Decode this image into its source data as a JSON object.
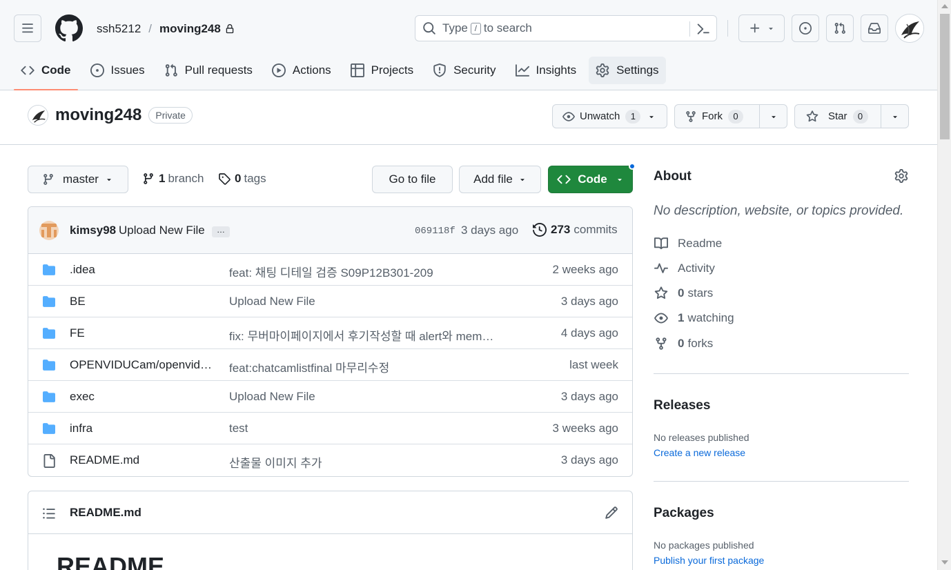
{
  "colors": {
    "accent_green": "#1f883d",
    "link_blue": "#0969da",
    "folder_blue": "#54aeff",
    "tab_underline": "#fd8c73",
    "muted_text": "#57606a",
    "border": "#d0d7de"
  },
  "header": {
    "owner": "ssh5212",
    "separator": "/",
    "repo": "moving248",
    "search": {
      "prefix": "Type",
      "key": "/",
      "suffix": "to search"
    }
  },
  "tabs": [
    {
      "label": "Code",
      "icon": "code-icon"
    },
    {
      "label": "Issues",
      "icon": "issue-icon"
    },
    {
      "label": "Pull requests",
      "icon": "pull-request-icon"
    },
    {
      "label": "Actions",
      "icon": "play-icon"
    },
    {
      "label": "Projects",
      "icon": "table-icon"
    },
    {
      "label": "Security",
      "icon": "shield-icon"
    },
    {
      "label": "Insights",
      "icon": "graph-icon"
    },
    {
      "label": "Settings",
      "icon": "gear-icon"
    }
  ],
  "repo": {
    "name": "moving248",
    "visibility": "Private",
    "watch": {
      "label": "Unwatch",
      "count": "1"
    },
    "fork": {
      "label": "Fork",
      "count": "0"
    },
    "star": {
      "label": "Star",
      "count": "0"
    }
  },
  "branch_bar": {
    "branch": "master",
    "branches_count": "1",
    "branches_label": "branch",
    "tags_count": "0",
    "tags_label": "tags",
    "go_to_file": "Go to file",
    "add_file": "Add file",
    "code": "Code"
  },
  "latest_commit": {
    "author": "kimsy98",
    "message": "Upload New File",
    "ellipsis": "…",
    "sha": "069118f",
    "date": "3 days ago",
    "commits_count": "273",
    "commits_label": "commits"
  },
  "files": [
    {
      "name": ".idea",
      "type": "dir",
      "message": "feat: 채팅 디테일 검증 S09P12B301-209",
      "date": "2 weeks ago"
    },
    {
      "name": "BE",
      "type": "dir",
      "message": "Upload New File",
      "date": "3 days ago"
    },
    {
      "name": "FE",
      "type": "dir",
      "message": "fix: 무버마이페이지에서 후기작성할 때 alert와 mem…",
      "date": "4 days ago"
    },
    {
      "name": "OPENVIDUCam/openvid…",
      "type": "dir",
      "message": "feat:chatcamlistfinal 마무리수정",
      "date": "last week"
    },
    {
      "name": "exec",
      "type": "dir",
      "message": "Upload New File",
      "date": "3 days ago"
    },
    {
      "name": "infra",
      "type": "dir",
      "message": "test",
      "date": "3 weeks ago"
    },
    {
      "name": "README.md",
      "type": "file",
      "message": "산출물 이미지 추가",
      "date": "3 days ago"
    }
  ],
  "readme": {
    "filename": "README.md",
    "heading": "README"
  },
  "about": {
    "title": "About",
    "description": "No description, website, or topics provided.",
    "readme": "Readme",
    "activity": "Activity",
    "stars_count": "0",
    "stars_label": "stars",
    "watching_count": "1",
    "watching_label": "watching",
    "forks_count": "0",
    "forks_label": "forks"
  },
  "releases": {
    "title": "Releases",
    "empty": "No releases published",
    "link": "Create a new release"
  },
  "packages": {
    "title": "Packages",
    "empty": "No packages published",
    "link": "Publish your first package"
  }
}
